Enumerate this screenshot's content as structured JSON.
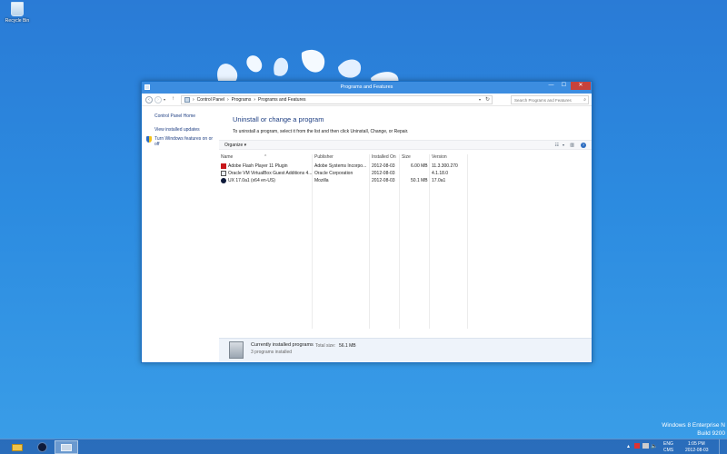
{
  "desktop": {
    "recycle_bin_label": "Recycle Bin"
  },
  "window": {
    "title": "Programs and Features",
    "controls": {
      "minimize": "—",
      "maximize": "☐",
      "close": "✕"
    }
  },
  "address": {
    "breadcrumbs": [
      "Control Panel",
      "Programs",
      "Programs and Features"
    ],
    "search_placeholder": "Search Programs and Features"
  },
  "left_pane": {
    "links": [
      "Control Panel Home",
      "View installed updates",
      "Turn Windows features on or off"
    ]
  },
  "main": {
    "heading": "Uninstall or change a program",
    "subtext": "To uninstall a program, select it from the list and then click Uninstall, Change, or Repair.",
    "organize_label": "Organize ▾",
    "columns": [
      "Name",
      "Publisher",
      "Installed On",
      "Size",
      "Version"
    ],
    "programs": [
      {
        "name": "Adobe Flash Player 11 Plugin",
        "publisher": "Adobe Systems Incorpo...",
        "installed_on": "2012-08-03",
        "size": "6.00 MB",
        "version": "11.3.300.270",
        "icon": "flash-icon",
        "icon_color": "#c8171b"
      },
      {
        "name": "Oracle VM VirtualBox Guest Additions 4...",
        "publisher": "Oracle Corporation",
        "installed_on": "2012-08-03",
        "size": "",
        "version": "4.1.18.0",
        "icon": "virtualbox-icon",
        "icon_color": "#e8eef6"
      },
      {
        "name": "UX 17.0a1 (x64 en-US)",
        "publisher": "Mozilla",
        "installed_on": "2012-08-03",
        "size": "50.1 MB",
        "version": "17.0a1",
        "icon": "nightly-icon",
        "icon_color": "#0e1a3a"
      }
    ]
  },
  "details": {
    "title": "Currently installed programs",
    "total_size_label": "Total size:",
    "total_size": "56.1 MB",
    "count_text": "3 programs installed"
  },
  "watermark": {
    "line1": "Windows 8 Enterprise N",
    "line2": "Build 9200"
  },
  "tray": {
    "language": "ENG",
    "layout": "CMS",
    "time": "1:05 PM",
    "date": "2012-08-03"
  }
}
